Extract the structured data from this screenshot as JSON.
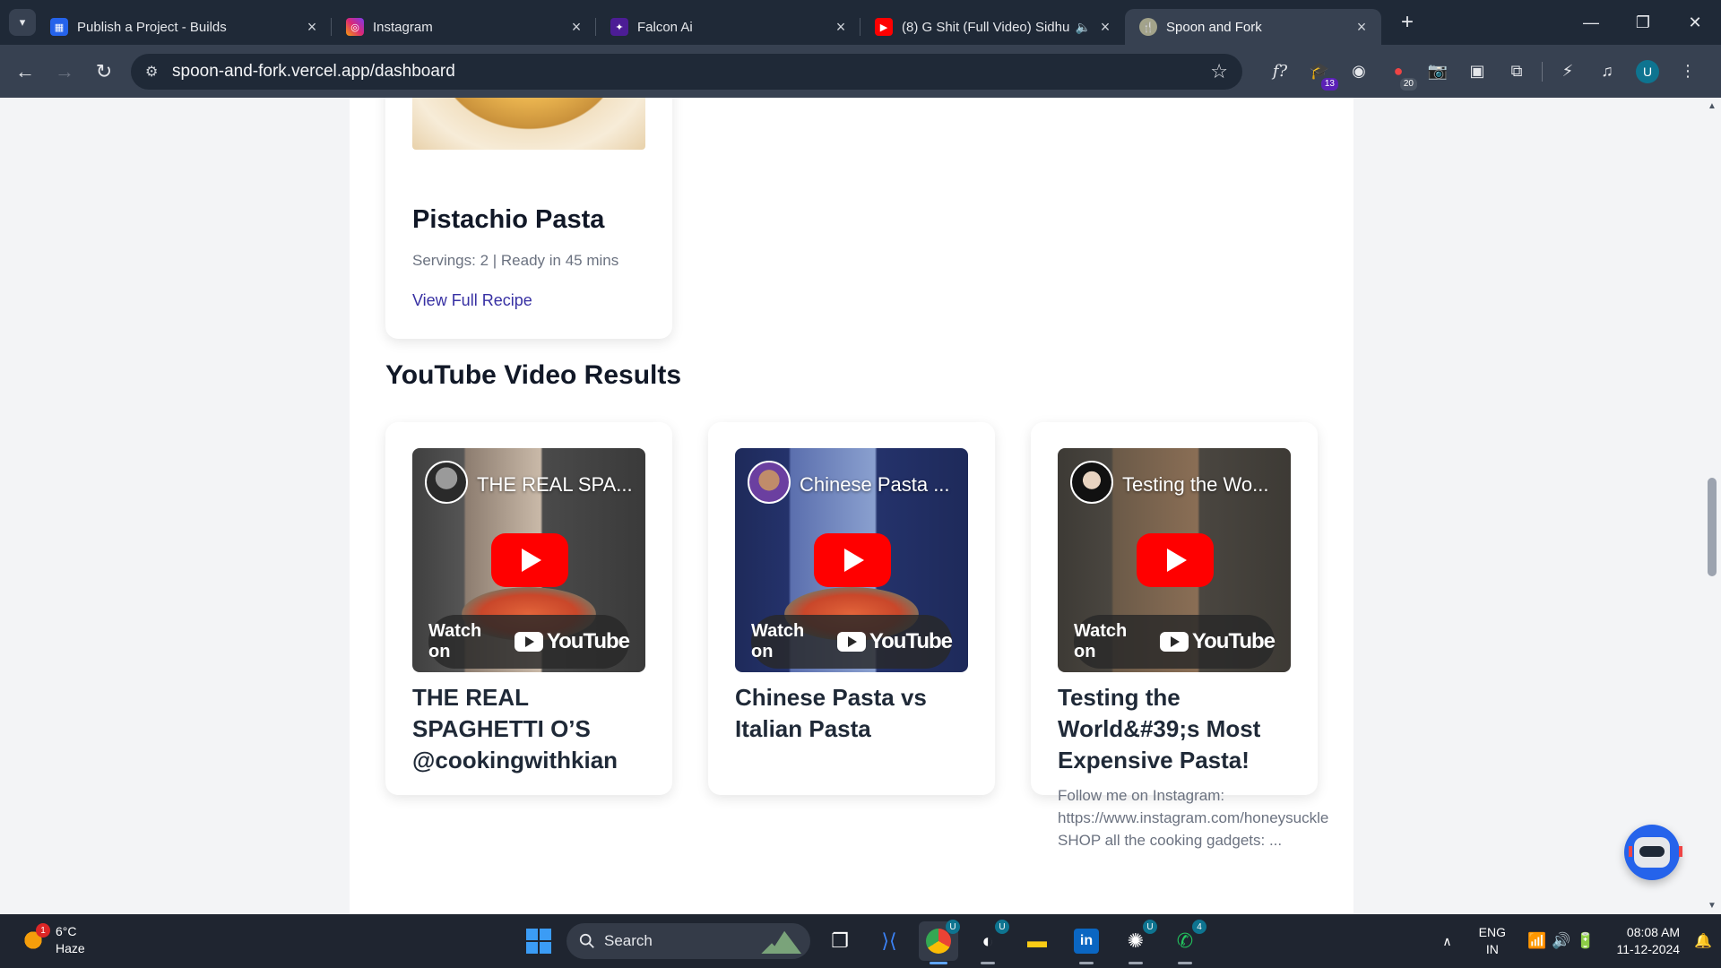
{
  "browser": {
    "tabs": [
      {
        "title": "Publish a Project - Builds",
        "favicon": "builds-icon",
        "active": false
      },
      {
        "title": "Instagram",
        "favicon": "instagram-icon",
        "active": false
      },
      {
        "title": "Falcon Ai",
        "favicon": "falcon-icon",
        "active": false
      },
      {
        "title": "(8) G Shit (Full Video) Sidhu",
        "favicon": "youtube-icon",
        "active": false
      },
      {
        "title": "Spoon and Fork",
        "favicon": "spoon-fork-icon",
        "active": true
      }
    ],
    "url": "spoon-and-fork.vercel.app/dashboard",
    "extension_badges": {
      "ext1": "13",
      "ext2": "20"
    },
    "profile_initial": "U"
  },
  "page": {
    "recipe": {
      "title": "Pistachio Pasta",
      "meta": "Servings: 2 | Ready in 45 mins",
      "link": "View Full Recipe"
    },
    "youtube_section_title": "YouTube Video Results",
    "videos": [
      {
        "thumb_title": "THE REAL SPA...",
        "title": "THE REAL SPAGHETTI O’S @cookingwithkian",
        "description": ""
      },
      {
        "thumb_title": "Chinese Pasta ...",
        "title": "Chinese Pasta vs Italian Pasta",
        "description": ""
      },
      {
        "thumb_title": "Testing the Wo...",
        "title": "Testing the World&#39;s Most Expensive Pasta!",
        "description": "Follow me on Instagram: https://www.instagram.com/honeysuckle SHOP all the cooking gadgets: ..."
      }
    ],
    "watch_on": "Watch on",
    "youtube_word": "YouTube"
  },
  "taskbar": {
    "weather_badge": "1",
    "temperature": "6°C",
    "condition": "Haze",
    "search_label": "Search",
    "badges": {
      "copilot": "U",
      "chatgpt": "U",
      "whatsapp": "4",
      "chrome": "U"
    },
    "lang_top": "ENG",
    "lang_bottom": "IN",
    "time": "08:08 AM",
    "date": "11-12-2024"
  },
  "colors": {
    "link": "#3730a3",
    "youtube_red": "#ff0000",
    "browser_dark": "#1f2937"
  }
}
